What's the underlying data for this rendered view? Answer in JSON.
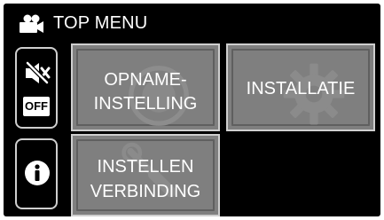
{
  "header": {
    "title": "TOP MENU",
    "icon": "video-camera-icon"
  },
  "side_buttons": {
    "mute": {
      "icon": "mute-icon",
      "badge": "OFF"
    },
    "info": {
      "icon": "info-icon"
    }
  },
  "tiles": {
    "record_settings": {
      "line1": "OPNAME-",
      "line2": "INSTELLING",
      "watermark_icon": "record-icon"
    },
    "setup": {
      "label": "INSTALLATIE",
      "watermark_icon": "gear-icon"
    },
    "connection_settings": {
      "line1": "INSTELLEN",
      "line2": "VERBINDING",
      "watermark_icon": "wrench-icon"
    }
  },
  "colors": {
    "screen_bg": "#000000",
    "tile_bg": "#7f7f7f",
    "tile_border": "#cfcfcf",
    "text": "#ffffff"
  }
}
